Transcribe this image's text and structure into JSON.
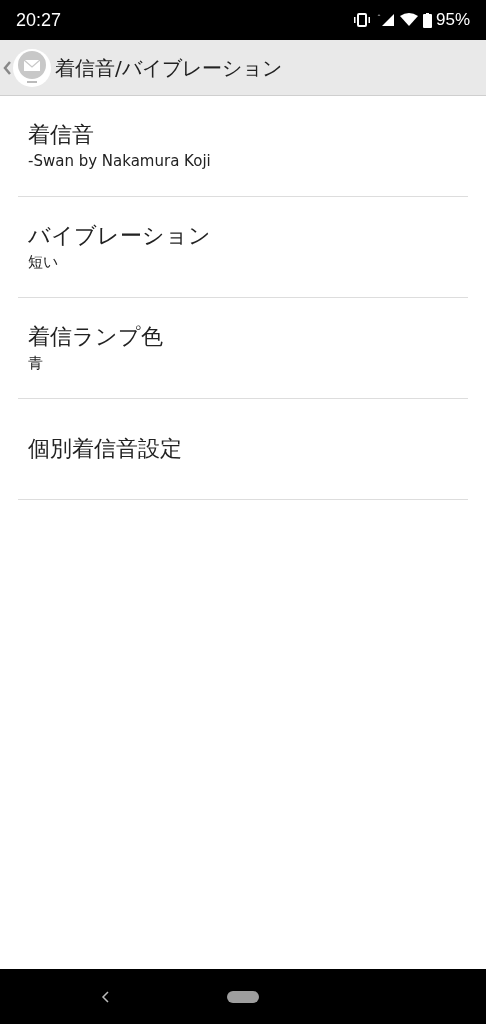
{
  "status_bar": {
    "time": "20:27",
    "battery": "95%"
  },
  "header": {
    "title": "着信音/バイブレーション"
  },
  "items": [
    {
      "title": "着信音",
      "subtitle": "-Swan by Nakamura Koji"
    },
    {
      "title": "バイブレーション",
      "subtitle": "短い"
    },
    {
      "title": "着信ランプ色",
      "subtitle": "青"
    },
    {
      "title": "個別着信音設定"
    }
  ]
}
